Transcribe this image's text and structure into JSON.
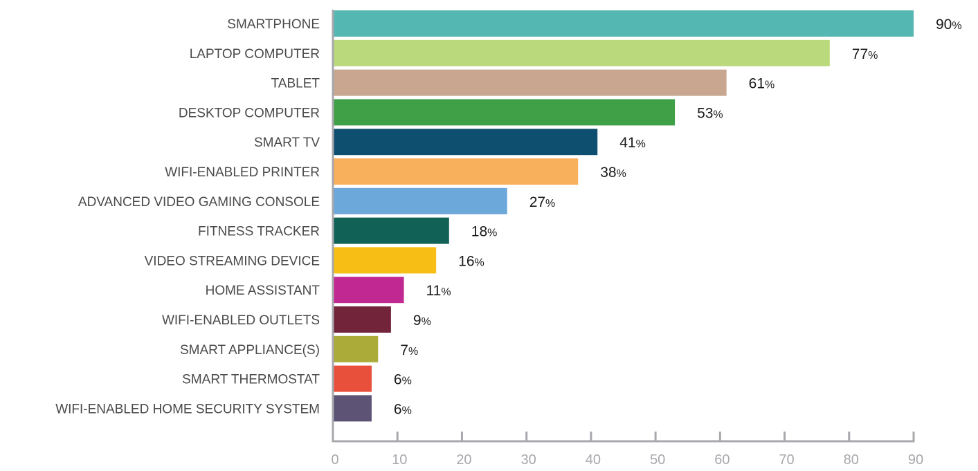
{
  "chart_data": {
    "type": "bar",
    "orientation": "horizontal",
    "title": "",
    "xlabel": "",
    "ylabel": "",
    "xlim": [
      0,
      90
    ],
    "xticks": [
      0,
      10,
      20,
      30,
      40,
      50,
      60,
      70,
      80,
      90
    ],
    "grid": false,
    "legend": "none",
    "value_suffix": "%",
    "categories": [
      "SMARTPHONE",
      "LAPTOP COMPUTER",
      "TABLET",
      "DESKTOP COMPUTER",
      "SMART TV",
      "WIFI-ENABLED PRINTER",
      "ADVANCED VIDEO GAMING CONSOLE",
      "FITNESS TRACKER",
      "VIDEO STREAMING DEVICE",
      "HOME ASSISTANT",
      "WIFI-ENABLED OUTLETS",
      "SMART APPLIANCE(S)",
      "SMART THERMOSTAT",
      "WIFI-ENABLED HOME SECURITY SYSTEM"
    ],
    "values": [
      90,
      77,
      61,
      53,
      41,
      38,
      27,
      18,
      16,
      11,
      9,
      7,
      6,
      6
    ],
    "colors": [
      "#55b7b1",
      "#bad97c",
      "#c9a68f",
      "#40a047",
      "#0e4f70",
      "#f9b05c",
      "#6da8db",
      "#126157",
      "#f7be16",
      "#c22891",
      "#72243b",
      "#abab39",
      "#e8503c",
      "#5c5375"
    ],
    "axis_color": "#a8a8ad"
  }
}
